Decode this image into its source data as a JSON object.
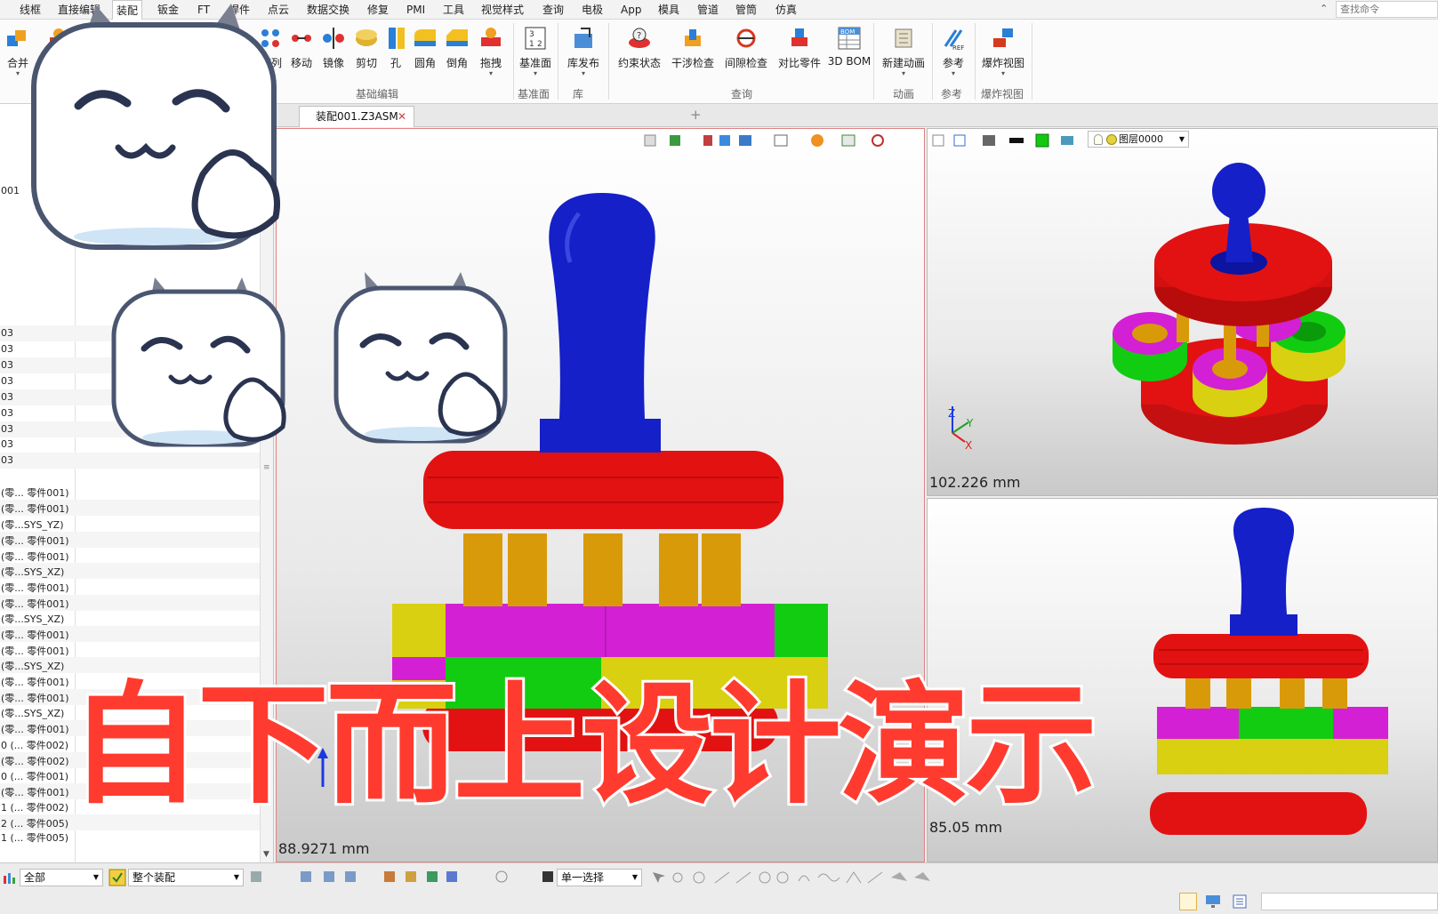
{
  "menu": {
    "items": [
      "线框",
      "直接编辑",
      "装配",
      "钣金",
      "FT",
      "焊件",
      "点云",
      "数据交换",
      "修复",
      "PMI",
      "工具",
      "视觉样式",
      "查询",
      "电极",
      "App",
      "模具",
      "管道",
      "管筒",
      "仿真"
    ],
    "search_placeholder": "查找命令"
  },
  "ribbon": {
    "buttons": [
      "合并",
      "阵列",
      "移动",
      "镜像",
      "剪切",
      "孔",
      "圆角",
      "倒角",
      "拖拽",
      "基准面",
      "库发布",
      "约束状态",
      "干涉检查",
      "间隙检查",
      "对比零件",
      "3D BOM",
      "新建动画",
      "参考",
      "爆炸视图"
    ],
    "groups": [
      "基础编辑",
      "基准面",
      "库",
      "查询",
      "动画",
      "参考",
      "爆炸视图"
    ],
    "icon_texts": [
      "BOM",
      "REF",
      "3",
      "1",
      "2"
    ]
  },
  "tree": {
    "rows": [
      "001",
      "03",
      "03",
      "03",
      "03",
      "03",
      "03",
      "03",
      "03",
      "03",
      "(零... 零件001)",
      "(零... 零件001)",
      "(零...SYS_YZ)",
      "(零... 零件001)",
      "(零... 零件001)",
      "(零...SYS_XZ)",
      "(零... 零件001)",
      "(零... 零件001)",
      "(零...SYS_XZ)",
      "(零... 零件001)",
      "(零... 零件001)",
      "(零...SYS_XZ)",
      "(零... 零件001)",
      "(零... 零件001)",
      "(零...SYS_XZ)",
      "(零... 零件001)",
      "0 (... 零件002)",
      "(零... 零件002)",
      "0 (... 零件001)",
      "(零... 零件001)",
      "1 (... 零件002)",
      "2 (... 零件005)",
      "1 (... 零件005)"
    ]
  },
  "tabs": {
    "document": "装配001.Z3ASM",
    "add": "+"
  },
  "viewports": {
    "main_measure": "88.9271 mm",
    "top_right_measure": "102.226 mm",
    "bottom_right_measure": "85.05 mm",
    "layer": "图层0000",
    "axis_labels": [
      "Z",
      "Y",
      "X"
    ]
  },
  "statusbar": {
    "filter": "全部",
    "scope": "整个装配",
    "selection_mode": "单一选择"
  },
  "overlay": {
    "title": "自下而上设计演示"
  },
  "colors": {
    "handle": "#1520c8",
    "disc": "#e21212",
    "rod": "#d99a0a",
    "magenta": "#d420d4",
    "green": "#12cc12",
    "yellow": "#d8d010",
    "title": "#ff3b2f"
  }
}
